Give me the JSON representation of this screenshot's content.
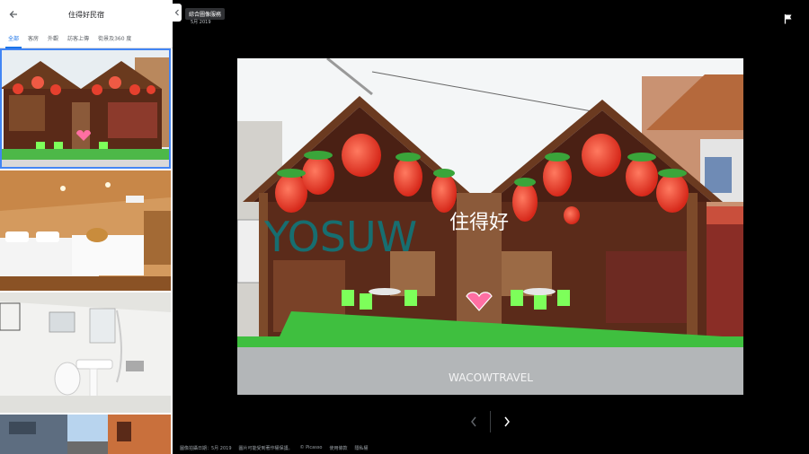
{
  "panel": {
    "title": "住得好民宿",
    "tabs": [
      "全部",
      "客房",
      "外觀",
      "訪客上傳",
      "街景及360 度"
    ],
    "active_tab": 0
  },
  "source": {
    "tooltip": "綜合圖像服務",
    "date": "5月 2019"
  },
  "photo": {
    "sign_text": "住得好",
    "watermark_overlay": "YOSUW",
    "watermark_bottom": "WACOWTRAVEL"
  },
  "footer": {
    "items": [
      "圖像拍攝日期：5月 2019",
      "圖片可能受到著作權保護。",
      "© Picasso",
      "使用條款",
      "隱私權"
    ]
  },
  "colors": {
    "accent": "#1a73e8",
    "selected_outline": "#4285f4"
  }
}
